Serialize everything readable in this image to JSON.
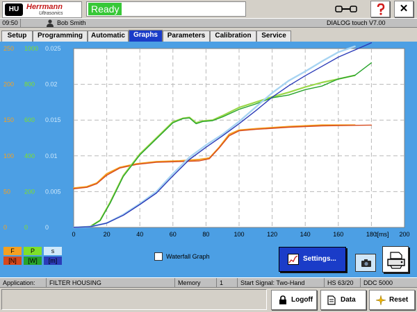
{
  "header": {
    "logo_mark": "HU",
    "logo_name": "Herrmann",
    "logo_sub": "Ultrasonics",
    "status": "Ready"
  },
  "infobar": {
    "time": "09:50",
    "user": "Bob Smith",
    "version": "DIALOG touch V7.00"
  },
  "tabs": [
    {
      "label": "Setup",
      "active": false
    },
    {
      "label": "Programming",
      "active": false
    },
    {
      "label": "Automatic",
      "active": false
    },
    {
      "label": "Graphs",
      "active": true
    },
    {
      "label": "Parameters",
      "active": false
    },
    {
      "label": "Calibration",
      "active": false
    },
    {
      "label": "Service",
      "active": false
    }
  ],
  "legend": {
    "f": "F",
    "p": "P",
    "s": "s",
    "f_unit": "[N]",
    "p_unit": "[W]",
    "s_unit": "[m]"
  },
  "waterfall_label": "Waterfall Graph",
  "settings_label": "Settings...",
  "statusbar": {
    "application_label": "Application:",
    "application_value": "FILTER HOUSING",
    "memory_label": "Memory",
    "memory_value": "1",
    "start_signal": "Start Signal:  Two-Hand",
    "hs": "HS 63/20",
    "ddc": "DDC 5000"
  },
  "buttons": {
    "logoff": "Logoff",
    "data": "Data",
    "reset": "Reset"
  },
  "colors": {
    "accent": "#1a3cc8",
    "graph_bg": "#4c9fe4",
    "status_green": "#37c837",
    "force": "#d6481c",
    "force_ref": "#f5a020",
    "power": "#27a32b",
    "power_ref": "#9ad848",
    "distance": "#2b3bb8",
    "distance_ref": "#a7d4f2"
  },
  "chart_data": {
    "type": "line",
    "xlabel": "t[ms]",
    "xlim": [
      0,
      200
    ],
    "x_ticks": [
      0,
      20,
      40,
      60,
      80,
      100,
      120,
      140,
      160,
      180,
      200
    ],
    "y_axes": [
      {
        "name": "F",
        "color": "#f5a020",
        "ylim": [
          0,
          250
        ],
        "ticks": [
          0,
          50,
          100,
          150,
          200,
          250
        ]
      },
      {
        "name": "P",
        "color": "#7ee02a",
        "ylim": [
          0,
          1000
        ],
        "ticks": [
          0,
          200,
          400,
          600,
          800,
          1000
        ]
      },
      {
        "name": "s",
        "color": "#cfe9fb",
        "ylim": [
          0,
          0.025
        ],
        "ticks": [
          "0",
          "0.005",
          "0.01",
          "0.015",
          "0.02",
          "0.025"
        ]
      }
    ],
    "grid": true,
    "series": [
      {
        "name": "F",
        "axis": "F",
        "color": "#f5a020",
        "width": 2,
        "points": [
          [
            0,
            55
          ],
          [
            8,
            57
          ],
          [
            14,
            62
          ],
          [
            20,
            75
          ],
          [
            28,
            84
          ],
          [
            38,
            89
          ],
          [
            50,
            92
          ],
          [
            64,
            93
          ],
          [
            76,
            95
          ],
          [
            82,
            97
          ],
          [
            88,
            112
          ],
          [
            94,
            130
          ],
          [
            100,
            136
          ],
          [
            110,
            138
          ],
          [
            130,
            141
          ],
          [
            150,
            143
          ],
          [
            170,
            143
          ]
        ]
      },
      {
        "name": "F",
        "axis": "F",
        "color": "#d6481c",
        "width": 1.4,
        "points": [
          [
            0,
            54
          ],
          [
            8,
            56
          ],
          [
            14,
            61
          ],
          [
            20,
            73
          ],
          [
            28,
            83
          ],
          [
            38,
            88
          ],
          [
            50,
            91
          ],
          [
            64,
            92
          ],
          [
            76,
            93
          ],
          [
            82,
            96
          ],
          [
            88,
            111
          ],
          [
            94,
            128
          ],
          [
            100,
            135
          ],
          [
            110,
            137
          ],
          [
            130,
            140
          ],
          [
            150,
            142
          ],
          [
            180,
            143
          ]
        ]
      },
      {
        "name": "P",
        "axis": "P",
        "color": "#9ad848",
        "width": 2.2,
        "points": [
          [
            0,
            0
          ],
          [
            10,
            5
          ],
          [
            16,
            40
          ],
          [
            22,
            140
          ],
          [
            30,
            290
          ],
          [
            40,
            410
          ],
          [
            50,
            500
          ],
          [
            60,
            590
          ],
          [
            66,
            610
          ],
          [
            70,
            615
          ],
          [
            74,
            585
          ],
          [
            78,
            595
          ],
          [
            84,
            600
          ],
          [
            90,
            625
          ],
          [
            100,
            670
          ],
          [
            110,
            700
          ],
          [
            120,
            730
          ],
          [
            130,
            755
          ],
          [
            140,
            785
          ],
          [
            150,
            810
          ],
          [
            160,
            830
          ],
          [
            170,
            850
          ]
        ]
      },
      {
        "name": "P",
        "axis": "P",
        "color": "#27a32b",
        "width": 1.4,
        "points": [
          [
            0,
            0
          ],
          [
            10,
            4
          ],
          [
            16,
            38
          ],
          [
            22,
            135
          ],
          [
            30,
            285
          ],
          [
            40,
            405
          ],
          [
            50,
            495
          ],
          [
            60,
            585
          ],
          [
            66,
            608
          ],
          [
            70,
            612
          ],
          [
            74,
            580
          ],
          [
            78,
            592
          ],
          [
            84,
            597
          ],
          [
            90,
            618
          ],
          [
            100,
            660
          ],
          [
            110,
            690
          ],
          [
            120,
            725
          ],
          [
            130,
            740
          ],
          [
            140,
            770
          ],
          [
            150,
            790
          ],
          [
            160,
            830
          ],
          [
            170,
            850
          ],
          [
            180,
            920
          ]
        ]
      },
      {
        "name": "s",
        "axis": "s",
        "color": "#a7d4f2",
        "width": 2.4,
        "points": [
          [
            0,
            0
          ],
          [
            10,
            0.0001
          ],
          [
            20,
            0.0006
          ],
          [
            30,
            0.0018
          ],
          [
            40,
            0.0033
          ],
          [
            50,
            0.005
          ],
          [
            60,
            0.0075
          ],
          [
            70,
            0.0098
          ],
          [
            80,
            0.0115
          ],
          [
            90,
            0.013
          ],
          [
            100,
            0.0148
          ],
          [
            110,
            0.0168
          ],
          [
            120,
            0.0188
          ],
          [
            130,
            0.0205
          ],
          [
            140,
            0.0218
          ],
          [
            150,
            0.0232
          ],
          [
            160,
            0.0245
          ],
          [
            170,
            0.0253
          ]
        ]
      },
      {
        "name": "s",
        "axis": "s",
        "color": "#2b3bb8",
        "width": 1.4,
        "points": [
          [
            0,
            0
          ],
          [
            10,
            0.0001
          ],
          [
            20,
            0.0006
          ],
          [
            30,
            0.0017
          ],
          [
            40,
            0.0032
          ],
          [
            50,
            0.0048
          ],
          [
            60,
            0.0072
          ],
          [
            70,
            0.0095
          ],
          [
            80,
            0.0112
          ],
          [
            90,
            0.0128
          ],
          [
            100,
            0.0145
          ],
          [
            110,
            0.0163
          ],
          [
            120,
            0.0182
          ],
          [
            130,
            0.0198
          ],
          [
            140,
            0.0212
          ],
          [
            150,
            0.0225
          ],
          [
            160,
            0.0238
          ],
          [
            170,
            0.0248
          ],
          [
            180,
            0.0258
          ]
        ]
      }
    ]
  }
}
